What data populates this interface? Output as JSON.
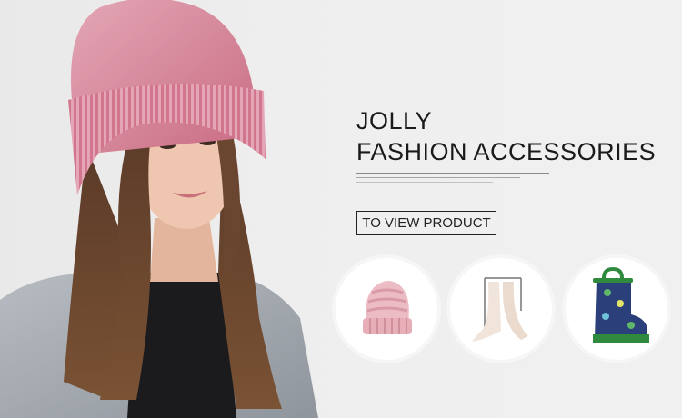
{
  "hero": {
    "title_line1": "JOLLY",
    "title_line2": "FASHION ACCESSORIES",
    "cta_label": "TO VIEW PRODUCT"
  },
  "products": [
    {
      "name": "knit-beanie-icon",
      "color": "#e9b8c0"
    },
    {
      "name": "scarf-icon",
      "color": "#efe2d8"
    },
    {
      "name": "rain-boot-icon",
      "color": "#2f8a3e"
    }
  ],
  "colors": {
    "hat_pink": "#d77c92",
    "coat_gray": "#a7adb4",
    "text": "#1a1a1a",
    "background": "#eeeeee"
  }
}
